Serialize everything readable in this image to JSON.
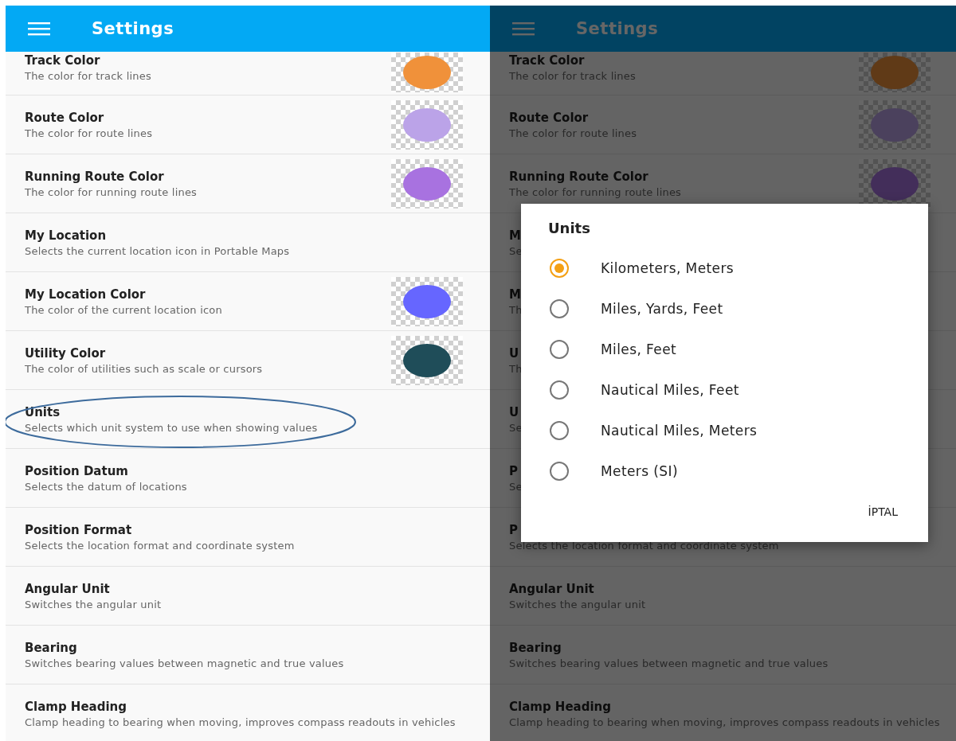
{
  "panels": [
    {
      "header": {
        "title": "Settings"
      },
      "rows": [
        {
          "title": "Track Color",
          "subtitle": "The color for track lines",
          "color": "#f0913a",
          "circled": false
        },
        {
          "title": "Route Color",
          "subtitle": "The color for route lines",
          "color": "#bba3e8",
          "circled": false
        },
        {
          "title": "Running Route Color",
          "subtitle": "The color for running route lines",
          "color": "#a872e0",
          "circled": false
        },
        {
          "title": "My Location",
          "subtitle": "Selects the current location icon in Portable Maps",
          "circled": false
        },
        {
          "title": "My Location Color",
          "subtitle": "The color of the current location icon",
          "color": "#6666ff",
          "circled": false
        },
        {
          "title": "Utility Color",
          "subtitle": "The color of utilities such as scale or cursors",
          "color": "#1f4d59",
          "circled": false
        },
        {
          "title": "Units",
          "subtitle": "Selects which unit system to use when showing values",
          "circled": true
        },
        {
          "title": "Position Datum",
          "subtitle": "Selects the datum of locations",
          "circled": false
        },
        {
          "title": "Position Format",
          "subtitle": "Selects the location format and coordinate system",
          "circled": false
        },
        {
          "title": "Angular Unit",
          "subtitle": "Switches the angular unit",
          "circled": false
        },
        {
          "title": "Bearing",
          "subtitle": "Switches bearing values between magnetic and true values",
          "circled": false
        },
        {
          "title": "Clamp Heading",
          "subtitle": "Clamp heading to bearing when moving, improves compass readouts in vehicles",
          "circled": false
        }
      ]
    },
    {
      "header": {
        "title": "Settings"
      },
      "rows": [
        {
          "title": "Track Color",
          "subtitle": "The color for track lines",
          "color": "#603a17"
        },
        {
          "title": "Route Color",
          "subtitle": "The color for route lines",
          "color": "#4b415d"
        },
        {
          "title": "Running Route Color",
          "subtitle": "The color for running route lines",
          "color": "#432e5a"
        },
        {
          "title": "M",
          "subtitle": "Se"
        },
        {
          "title": "M",
          "subtitle": "Th"
        },
        {
          "title": "U",
          "subtitle": "Th"
        },
        {
          "title": "U",
          "subtitle": "Se"
        },
        {
          "title": "P",
          "subtitle": "Se"
        },
        {
          "title": "P",
          "subtitle": "Selects the location format and coordinate system"
        },
        {
          "title": "Angular Unit",
          "subtitle": "Switches the angular unit"
        },
        {
          "title": "Bearing",
          "subtitle": "Switches bearing values between magnetic and true values"
        },
        {
          "title": "Clamp Heading",
          "subtitle": "Clamp heading to bearing when moving, improves compass readouts in vehicles"
        }
      ],
      "dialog": {
        "title": "Units",
        "options": [
          {
            "label": "Kilometers, Meters",
            "selected": true
          },
          {
            "label": "Miles, Yards, Feet",
            "selected": false
          },
          {
            "label": "Miles, Feet",
            "selected": false
          },
          {
            "label": "Nautical Miles, Feet",
            "selected": false
          },
          {
            "label": "Nautical Miles, Meters",
            "selected": false
          },
          {
            "label": "Meters (SI)",
            "selected": false
          }
        ],
        "buttons": [
          "İPTAL"
        ]
      }
    }
  ]
}
